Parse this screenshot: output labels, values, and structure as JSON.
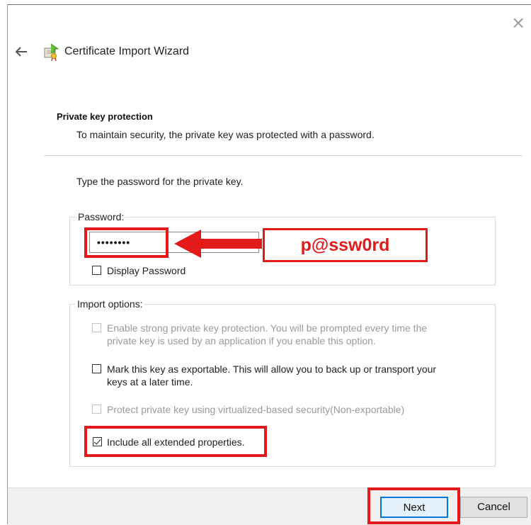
{
  "window": {
    "title": "Certificate Import Wizard",
    "close_glyph": "×",
    "icons": [
      "back-arrow-icon",
      "certificate-icon",
      "close-icon"
    ]
  },
  "header": {
    "section_title": "Private key protection",
    "section_description": "To maintain security, the private key was protected with a password."
  },
  "main": {
    "prompt": "Type the password for the private key.",
    "password_group": {
      "label": "Password:",
      "masked_value": "••••••••",
      "display_password": {
        "label": "Display Password",
        "checked": false
      }
    },
    "callout": {
      "text": "p@ssw0rd",
      "color": "#e31a1a"
    },
    "import_options": {
      "label": "Import options:",
      "options": [
        {
          "line1": "Enable strong private key protection. You will be prompted every time the",
          "line2": "private key is used by an application if you enable this option.",
          "checked": false,
          "enabled": false
        },
        {
          "line1": "Mark this key as exportable. This will allow you to back up or transport your",
          "line2": "keys at a later time.",
          "checked": false,
          "enabled": true
        },
        {
          "line1": "Protect private key using virtualized-based security(Non-exportable)",
          "checked": false,
          "enabled": false
        },
        {
          "line1": "Include all extended properties.",
          "checked": true,
          "enabled": true
        }
      ]
    }
  },
  "footer": {
    "next_label": "Next",
    "cancel_label": "Cancel"
  },
  "colors": {
    "highlight": "#e31a1a",
    "accent": "#0078d7"
  }
}
